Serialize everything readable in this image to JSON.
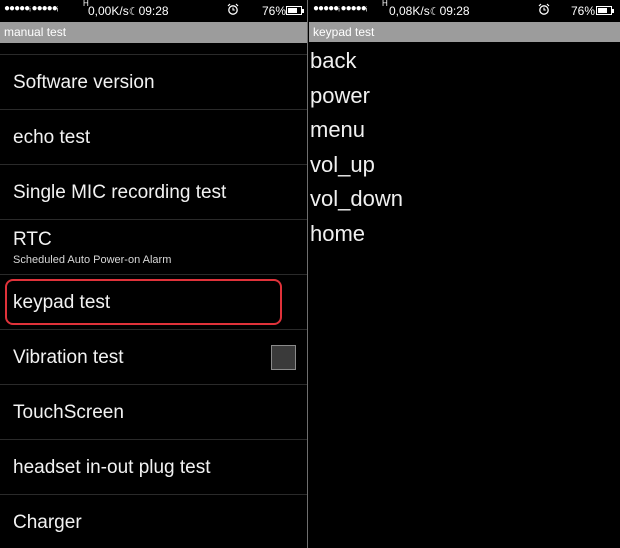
{
  "left": {
    "status": {
      "signal": "●●●●●ᵢ ●●●●●ᵢ",
      "h": "H",
      "speed": "0,00K/s",
      "time": "09:28",
      "battery": "76%",
      "battery_level": 0.76
    },
    "title": "manual test",
    "items": [
      {
        "label": "Software version"
      },
      {
        "label": "echo test"
      },
      {
        "label": "Single MIC recording test"
      },
      {
        "label": "RTC",
        "sub": "Scheduled Auto Power-on Alarm"
      },
      {
        "label": "keypad test",
        "highlighted": true
      },
      {
        "label": "Vibration test",
        "checked": false
      },
      {
        "label": "TouchScreen"
      },
      {
        "label": "headset in-out plug test"
      },
      {
        "label": "Charger"
      }
    ]
  },
  "right": {
    "status": {
      "signal": "●●●●●ᵢ ●●●●●ᵢ",
      "h": "H",
      "speed": "0,08K/s",
      "time": "09:28",
      "battery": "76%",
      "battery_level": 0.76
    },
    "title": "keypad test",
    "keys": [
      "back",
      "power",
      "menu",
      "vol_up",
      "vol_down",
      "home"
    ]
  },
  "colors": {
    "highlight": "#e0323a",
    "titlebar": "#9c9c9c"
  },
  "icons": {
    "moon": "moon-icon",
    "alarm": "alarm-clock-icon",
    "battery": "battery-icon"
  }
}
